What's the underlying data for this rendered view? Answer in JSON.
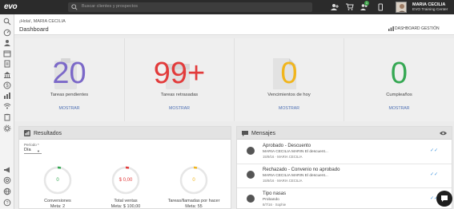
{
  "app": {
    "logo": "evo"
  },
  "topbar": {
    "search_placeholder": "Buscar clientes y prospectos",
    "notification_count": "1",
    "user": {
      "name": "MARIA CECILIA",
      "subtitle": "EVO Training Center"
    }
  },
  "header": {
    "greeting": "¡Hola!, MARIA CECILIA",
    "title": "Dashboard",
    "dashboard_button": "DASHBOARD GESTIÓN"
  },
  "stats": [
    {
      "value": "20",
      "label": "Tareas pendientes",
      "link": "MOSTRAR",
      "color": "#7b68c8"
    },
    {
      "value": "99+",
      "label": "Tareas retrasadas",
      "link": "MOSTRAR",
      "color": "#e23b3b"
    },
    {
      "value": "0",
      "label": "Vencimientos de hoy",
      "link": "MOSTRAR",
      "color": "#f1b51c"
    },
    {
      "value": "0",
      "label": "Cumpleaños",
      "link": "MOSTRAR",
      "color": "#35a853"
    }
  ],
  "results": {
    "title": "Resultados",
    "period_label": "Período *",
    "period_value": "Día",
    "gauges": [
      {
        "value": "0",
        "label": "Conversiones",
        "goal": "Meta: 2",
        "color": "#35a853"
      },
      {
        "value": "$ 0,00",
        "label": "Total ventas",
        "goal": "Meta: $ 100,00",
        "color": "#e23b3b"
      },
      {
        "value": "0",
        "label": "Tareas/llamadas por hacer",
        "goal": "Meta: 55",
        "color": "#f1b51c"
      }
    ]
  },
  "messages": {
    "title": "Mensajes",
    "items": [
      {
        "title": "Aprobado - Descuento",
        "preview": "MARIA CECILIA MARIN El descuent...",
        "meta": "15/9/16 · MARIA CECILIA"
      },
      {
        "title": "Rechazado - Convenio no aprobado",
        "preview": "MARIA CECILIA MARIN El descuent...",
        "meta": "15/9/16 · MARIA CECILIA"
      },
      {
        "title": "Tipo nasas",
        "preview": "Probando",
        "meta": "8/7/16 · Sophie"
      }
    ]
  }
}
